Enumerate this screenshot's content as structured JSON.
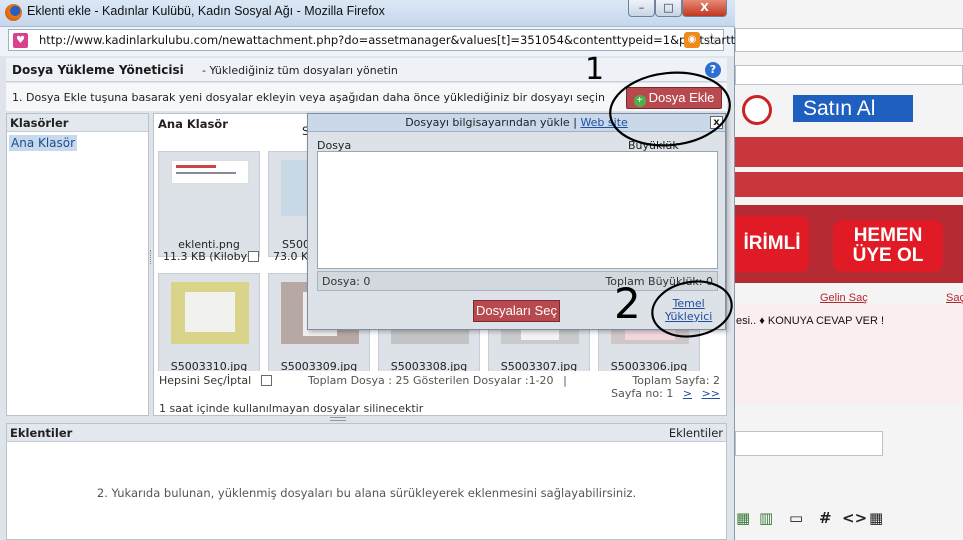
{
  "window": {
    "title": "Eklenti ekle - Kadınlar Kulübü, Kadın Sosyal Ağı - Mozilla Firefox",
    "url": "http://www.kadinlarkulubu.com/newattachment.php?do=assetmanager&values[t]=351054&contenttypeid=1&poststartt",
    "minimize": "–",
    "maximize": "□",
    "close": "X"
  },
  "manager": {
    "title": "Dosya Yükleme Yöneticisi",
    "subtitle": "- Yüklediğiniz tüm dosyaları yönetin",
    "help": "?",
    "instruction": "1. Dosya Ekle tuşuna basarak yeni dosyalar ekleyin veya aşağıdan daha önce yüklediğiniz bir dosyayı seçin",
    "add_button": "Dosya Ekle",
    "add_icon": "+"
  },
  "folders": {
    "header": "Klasörler",
    "items": [
      "Ana Klasör"
    ]
  },
  "files": {
    "header": "Ana Klasör",
    "header_s": "S",
    "thumbs": [
      {
        "name": "eklenti.png",
        "size": "11.3 KB (Kiloby"
      },
      {
        "name": "S500",
        "size": "73.0 K"
      },
      {
        "name": "S5003310.jpg",
        "size": ""
      },
      {
        "name": "S5003309.jpg",
        "size": ""
      },
      {
        "name": "S5003308.jpg",
        "size": ""
      },
      {
        "name": "S5003307.jpg",
        "size": ""
      },
      {
        "name": "S5003306.jpg",
        "size": ""
      }
    ],
    "select_all": "Hepsini Seç/İptal",
    "summary": "Toplam Dosya : 25 Gösterilen Dosyalar :1-20",
    "separator": "|",
    "total_pages": "Toplam Sayfa: 2",
    "page_label": "Sayfa no: 1",
    "page_next": ">",
    "page_last": ">>",
    "note": "1 saat içinde kullanılmayan dosyalar silinecektir"
  },
  "upload": {
    "title_a": "Dosyayı bilgisayarından yükle",
    "sep": "|",
    "title_b": "Web site",
    "close": "x",
    "col_file": "Dosya",
    "col_size": "Büyüklük",
    "count": "Dosya: 0",
    "total_size": "Toplam Büyüklük: 0",
    "select_button": "Dosyaları Seç",
    "basic_uploader_line1": "Temel",
    "basic_uploader_line2": "Yükleyici"
  },
  "attachments": {
    "header": "Eklentiler",
    "header_right": "Eklentiler",
    "message": "2. Yukarıda bulunan, yüklenmiş dosyaları bu alana sürükleyerek eklenmesini sağlayabilirsiniz."
  },
  "annotations": {
    "mark1": "1",
    "mark2": "2"
  },
  "background_page": {
    "buy_button": "Satın Al",
    "banner_left": "İRİMLİ",
    "banner_right_line1": "HEMEN",
    "banner_right_line2": "ÜYE OL",
    "link_welcome": "Gelin Saç",
    "link_sac": "Saç",
    "reply_text": "esi..  ♦ KONUYA CEVAP VER !",
    "toolbar_hash": "#",
    "toolbar_code": "<>"
  },
  "colors": {
    "accent_red": "#b84a4f",
    "link_blue": "#1f4fa0",
    "banner_red": "#e01b25"
  }
}
